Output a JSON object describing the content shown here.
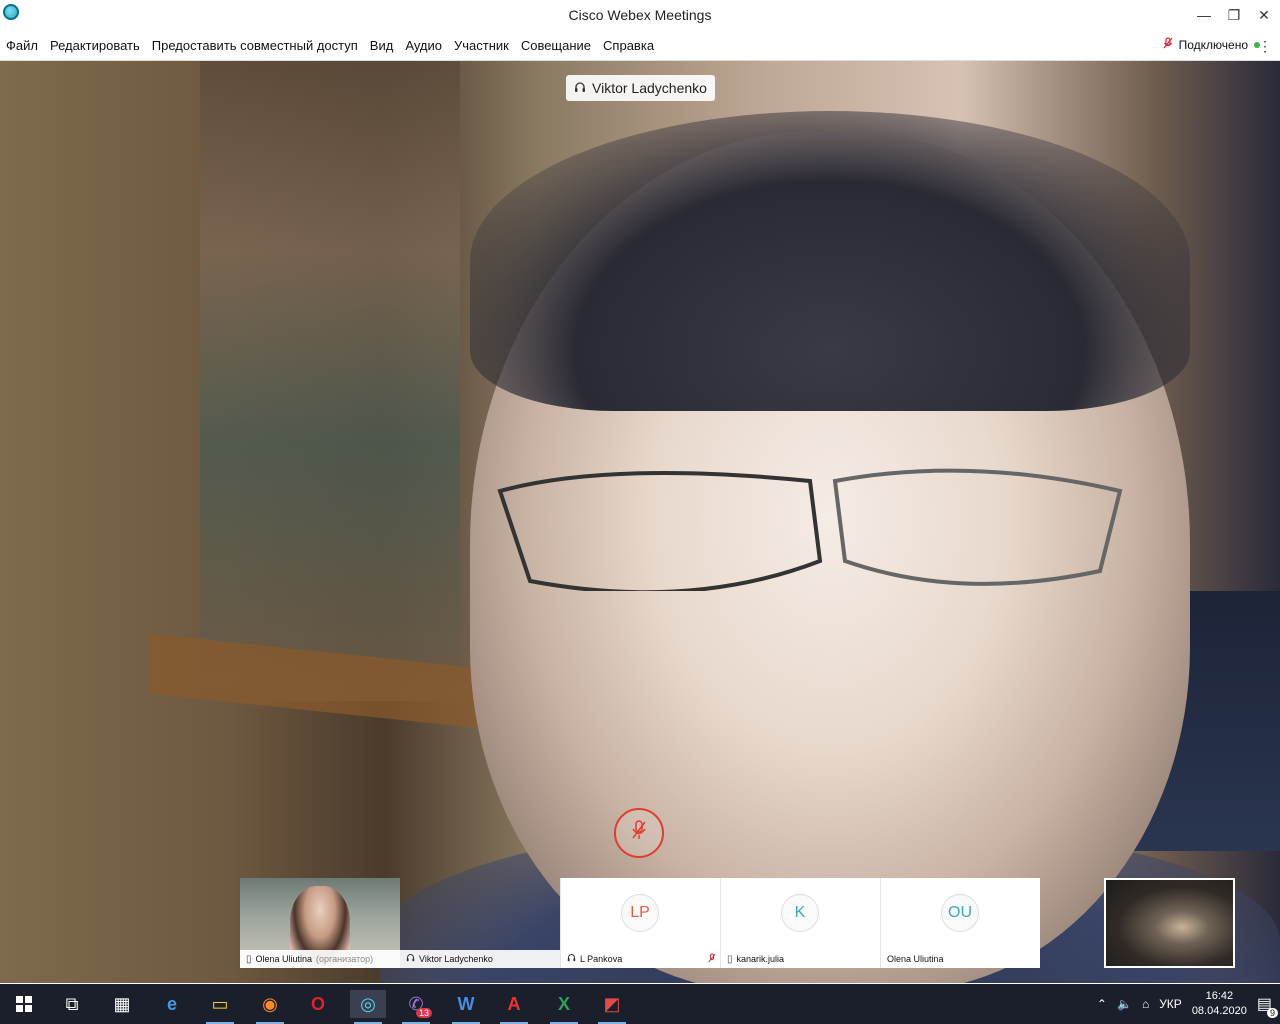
{
  "window": {
    "title": "Cisco Webex Meetings",
    "minimize_glyph": "—",
    "restore_glyph": "❐",
    "close_glyph": "✕"
  },
  "menu": {
    "items": [
      "Файл",
      "Редактировать",
      "Предоставить совместный доступ",
      "Вид",
      "Аудио",
      "Участник",
      "Совещание",
      "Справка"
    ]
  },
  "status": {
    "connection": "Подключено",
    "status_color": "#39b54a"
  },
  "speaker": {
    "name": "Viktor Ladychenko"
  },
  "filmstrip": [
    {
      "name": "Olena Uliutina",
      "role": "(организатор)",
      "icon": "phone-icon",
      "type": "video"
    },
    {
      "name": "Viktor Ladychenko",
      "role": "",
      "icon": "headset-icon",
      "type": "active-speaker"
    },
    {
      "name": "L Pankova",
      "role": "",
      "icon": "headset-icon",
      "initials": "LP",
      "muted": true
    },
    {
      "name": "kanarik.julia",
      "role": "",
      "icon": "phone-icon",
      "initials": "K"
    },
    {
      "name": "Olena Uliutina",
      "role": "",
      "icon": "",
      "initials": "OU"
    }
  ],
  "taskbar": {
    "apps": [
      {
        "name": "start",
        "glyph": "⊞"
      },
      {
        "name": "task-view",
        "glyph": "⧉"
      },
      {
        "name": "calculator",
        "glyph": "▦"
      },
      {
        "name": "edge",
        "glyph": "e"
      },
      {
        "name": "file-explorer",
        "glyph": "▭"
      },
      {
        "name": "firefox",
        "glyph": "◉"
      },
      {
        "name": "opera",
        "glyph": "O"
      },
      {
        "name": "webex",
        "glyph": "◎"
      },
      {
        "name": "viber",
        "glyph": "✆",
        "badge": "13"
      },
      {
        "name": "word",
        "glyph": "W"
      },
      {
        "name": "acrobat",
        "glyph": "A"
      },
      {
        "name": "excel",
        "glyph": "X"
      },
      {
        "name": "chart-app",
        "glyph": "◩"
      }
    ],
    "language": "УКР",
    "time": "16:42",
    "date": "08.04.2020",
    "notifications": "9"
  }
}
